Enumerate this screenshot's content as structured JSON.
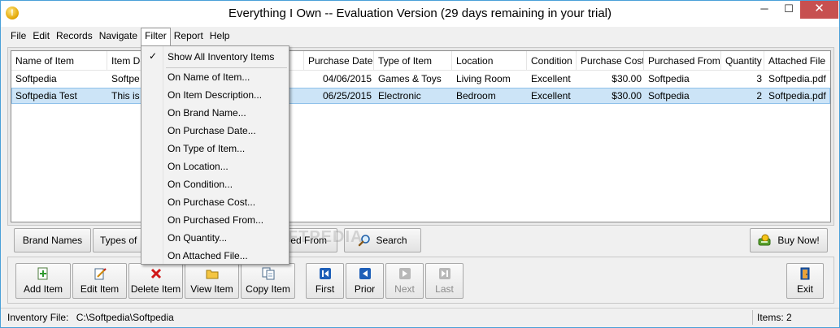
{
  "window": {
    "title": "Everything I Own -- Evaluation Version (29 days remaining in your trial)",
    "min_glyph": "─",
    "max_glyph": "☐",
    "close_glyph": "✕"
  },
  "menu": {
    "file": "File",
    "edit": "Edit",
    "records": "Records",
    "navigate": "Navigate",
    "filter": "Filter",
    "report": "Report",
    "help": "Help"
  },
  "list": {
    "columns": [
      "Name of Item",
      "Item De",
      "",
      "Purchase Date",
      "Type of Item",
      "Location",
      "Condition",
      "Purchase Cost",
      "Purchased From",
      "Quantity",
      "Attached File"
    ],
    "rows": [
      {
        "name": "Softpedia",
        "description": "Softpe",
        "purchase_date": "04/06/2015",
        "type": "Games & Toys",
        "location": "Living Room",
        "condition": "Excellent",
        "cost": "$30.00",
        "purchased_from": "Softpedia",
        "quantity": "3",
        "file": "Softpedia.pdf"
      },
      {
        "name": "Softpedia Test",
        "description": "This is a",
        "purchase_date": "06/25/2015",
        "type": "Electronic",
        "location": "Bedroom",
        "condition": "Excellent",
        "cost": "$30.00",
        "purchased_from": "Softpedia",
        "quantity": "2",
        "file": "Softpedia.pdf"
      }
    ]
  },
  "filter_bar": {
    "brand_names": "Brand Names",
    "types_of": "Types of",
    "purchased_from": "ed From",
    "search": "Search",
    "buy_now": "Buy Now!"
  },
  "toolbar": {
    "add": "Add Item",
    "edit": "Edit Item",
    "delete": "Delete Item",
    "view": "View Item",
    "copy": "Copy Item",
    "first": "First",
    "prior": "Prior",
    "next": "Next",
    "last": "Last",
    "exit": "Exit"
  },
  "status": {
    "file_label": "Inventory File:",
    "file_path": "C:\\Softpedia\\Softpedia",
    "items": "Items: 2"
  },
  "filter_menu": {
    "check_glyph": "✓",
    "items": [
      "Show All Inventory Items",
      "On Name of Item...",
      "On Item Description...",
      "On Brand Name...",
      "On Purchase Date...",
      "On Type of Item...",
      "On Location...",
      "On Condition...",
      "On Purchase Cost...",
      "On Purchased From...",
      "On Quantity...",
      "On Attached File..."
    ]
  },
  "watermark": "SOFTPEDIA",
  "colors": {
    "selection": "#cce4f7",
    "close_button": "#c75050",
    "frame_accent": "#4aa0d8"
  }
}
